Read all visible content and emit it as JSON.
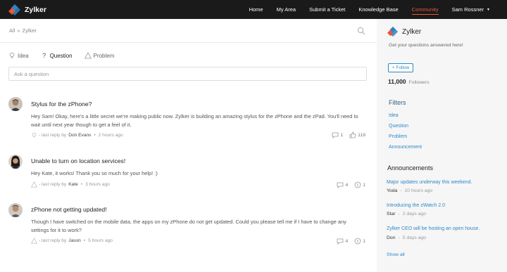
{
  "brand": {
    "name": "Zylker"
  },
  "nav": {
    "items": [
      "Home",
      "My Area",
      "Submit a Ticket",
      "Knowledge Base",
      "Community"
    ],
    "user": "Sam Rossner"
  },
  "breadcrumb": {
    "root": "All",
    "separator": "»",
    "current": "Zylker"
  },
  "tabs": [
    "Idea",
    "Question",
    "Problem"
  ],
  "ask": {
    "placeholder": "Ask a question"
  },
  "posts": [
    {
      "title": "Stylus for the zPhone?",
      "body": "Hey Sam! Okay, here's a little secret we're making public now. Zylker is building an amazing stylus for the zPhone and the zPad. You'll need to wait until next year though to get a feel of it.",
      "meta_prefix": "last reply by",
      "author": "Don Evans",
      "time": "2 hours ago",
      "comments": "1",
      "likes": "118"
    },
    {
      "title": "Unable to turn on location services!",
      "body": "Hey Kate, it works! Thank you so much for your help! :)",
      "meta_prefix": "last reply by",
      "author": "Kate",
      "time": "3 hours ago",
      "comments": "4",
      "votes": "1"
    },
    {
      "title": "zPhone not getting updated!",
      "body": "Though I have switched on the mobile data, the apps on my zPhone do not get updated. Could you please tell me if I have to change any settings for it to work?",
      "meta_prefix": "last reply by",
      "author": "Jason",
      "time": "5 hours ago",
      "comments": "4",
      "votes": "1"
    }
  ],
  "sidebar": {
    "name": "Zylker",
    "tagline": "Get your questions answered here!",
    "follow_label": "+ Follow",
    "followers_count": "11,000",
    "followers_label": "Followers",
    "filters_heading": "Filters",
    "filters": [
      "Idea",
      "Question",
      "Problem",
      "Announcement"
    ],
    "announcements_heading": "Announcements",
    "announcements": [
      {
        "title": "Major updates underway this weekend.",
        "author": "Yoda",
        "time": "10 hours ago"
      },
      {
        "title": "Introducing the zWatch 2.0",
        "author": "Star",
        "time": "2 days ago"
      },
      {
        "title": "Zylker CEO will be hosting an open house.",
        "author": "Don",
        "time": "5 days ago"
      }
    ],
    "show_all": "Show all"
  },
  "colors": {
    "topbar": "#1a1a1a",
    "accent": "#e8563a",
    "link": "#2f88c7"
  }
}
